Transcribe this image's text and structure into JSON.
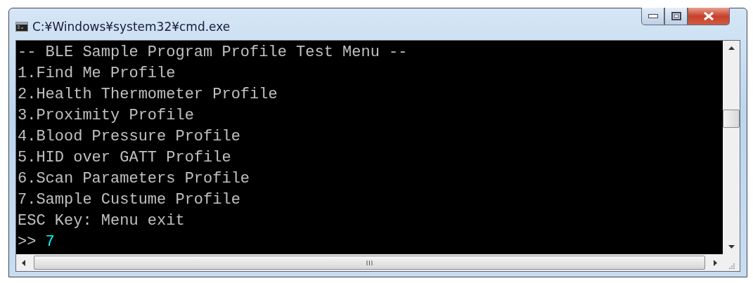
{
  "window": {
    "title": "C:¥Windows¥system32¥cmd.exe"
  },
  "console": {
    "lines": [
      {
        "kind": "text",
        "text": "-- BLE Sample Program Profile Test Menu --"
      },
      {
        "kind": "text",
        "text": "1.Find Me Profile"
      },
      {
        "kind": "text",
        "text": "2.Health Thermometer Profile"
      },
      {
        "kind": "text",
        "text": "3.Proximity Profile"
      },
      {
        "kind": "text",
        "text": "4.Blood Pressure Profile"
      },
      {
        "kind": "text",
        "text": "5.HID over GATT Profile"
      },
      {
        "kind": "text",
        "text": "6.Scan Parameters Profile"
      },
      {
        "kind": "text",
        "text": "7.Sample Custume Profile"
      },
      {
        "kind": "text",
        "text": "ESC Key: Menu exit"
      },
      {
        "kind": "prompt",
        "prompt": ">>",
        "input": "7"
      }
    ]
  }
}
